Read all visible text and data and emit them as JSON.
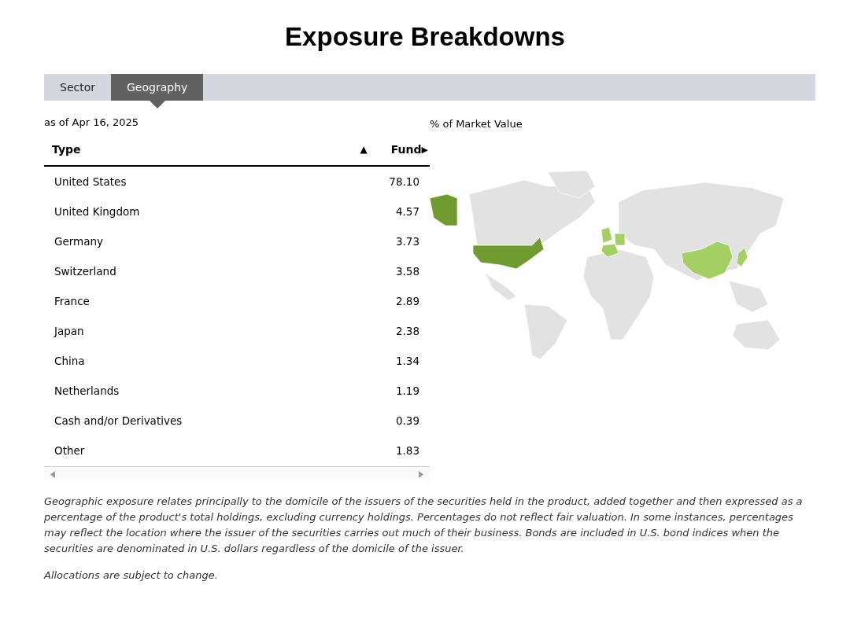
{
  "title": "Exposure Breakdowns",
  "tabs": [
    {
      "label": "Sector",
      "selected": false
    },
    {
      "label": "Geography",
      "selected": true
    }
  ],
  "as_of": "as of Apr 16, 2025",
  "map_caption": "% of Market Value",
  "table": {
    "columns": [
      {
        "label": "Type",
        "sort_indicator": "▲"
      },
      {
        "label": "Fund",
        "sort_indicator": "▶"
      }
    ],
    "rows": [
      {
        "type": "United States",
        "fund": "78.10"
      },
      {
        "type": "United Kingdom",
        "fund": "4.57"
      },
      {
        "type": "Germany",
        "fund": "3.73"
      },
      {
        "type": "Switzerland",
        "fund": "3.58"
      },
      {
        "type": "France",
        "fund": "2.89"
      },
      {
        "type": "Japan",
        "fund": "2.38"
      },
      {
        "type": "China",
        "fund": "1.34"
      },
      {
        "type": "Netherlands",
        "fund": "1.19"
      },
      {
        "type": "Cash and/or Derivatives",
        "fund": "0.39"
      },
      {
        "type": "Other",
        "fund": "1.83"
      }
    ]
  },
  "footnotes": [
    "Geographic exposure relates principally to the domicile of the issuers of the securities held in the product, added together and then expressed as a percentage of the product's total holdings, excluding currency holdings. Percentages do not reflect fair valuation. In some instances, percentages may reflect the location where the issuer of the securities carries out much of their business. Bonds are included in U.S. bond indices when the securities are denominated in U.S. dollars regardless of the domicile of the issuer.",
    "Allocations are subject to change."
  ]
}
